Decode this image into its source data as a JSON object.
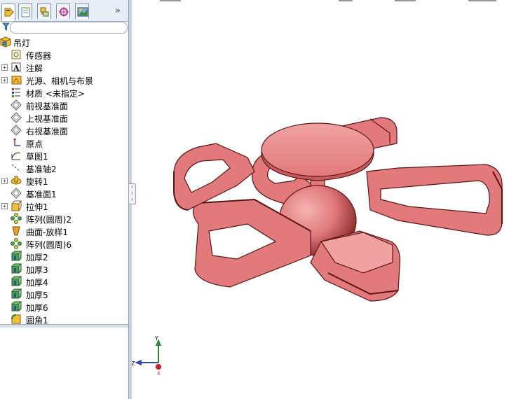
{
  "tabs": [
    {
      "name": "featuremanager-tab-icon",
      "color": "#e7b020"
    },
    {
      "name": "propertymanager-tab-icon",
      "color": "#5a7fb0"
    },
    {
      "name": "configurationmanager-tab-icon",
      "color": "#7a8a3a"
    },
    {
      "name": "dimxpert-tab-icon",
      "color": "#c2308a"
    },
    {
      "name": "display-manager-tab-icon",
      "color": "#3a8a3a"
    }
  ],
  "more_glyph": "»",
  "tree": {
    "root": "吊灯",
    "items": [
      {
        "label": "传感器",
        "icon": "sensor-icon",
        "expand": false
      },
      {
        "label": "注解",
        "icon": "annotation-icon",
        "expand": true
      },
      {
        "label": "光源、相机与布景",
        "icon": "lights-cameras-icon",
        "expand": true
      },
      {
        "label": "材质 <未指定>",
        "icon": "material-icon",
        "expand": false
      },
      {
        "label": "前视基准面",
        "icon": "plane-icon",
        "expand": false
      },
      {
        "label": "上视基准面",
        "icon": "plane-icon",
        "expand": false
      },
      {
        "label": "右视基准面",
        "icon": "plane-icon",
        "expand": false
      },
      {
        "label": "原点",
        "icon": "origin-icon",
        "expand": false
      },
      {
        "label": "草图1",
        "icon": "sketch-icon",
        "expand": false
      },
      {
        "label": "基准轴2",
        "icon": "axis-icon",
        "expand": false
      },
      {
        "label": "旋转1",
        "icon": "revolve-icon",
        "expand": true
      },
      {
        "label": "基准面1",
        "icon": "plane-icon",
        "expand": false
      },
      {
        "label": "拉伸1",
        "icon": "extrude-icon",
        "expand": true
      },
      {
        "label": "阵列(圆周)2",
        "icon": "circular-pattern-icon",
        "expand": false
      },
      {
        "label": "曲面-放样1",
        "icon": "surface-loft-icon",
        "expand": false
      },
      {
        "label": "阵列(圆周)6",
        "icon": "circular-pattern-icon",
        "expand": false
      },
      {
        "label": "加厚2",
        "icon": "thicken-icon",
        "expand": false
      },
      {
        "label": "加厚3",
        "icon": "thicken-icon",
        "expand": false
      },
      {
        "label": "加厚4",
        "icon": "thicken-icon",
        "expand": false
      },
      {
        "label": "加厚5",
        "icon": "thicken-icon",
        "expand": false
      },
      {
        "label": "加厚6",
        "icon": "thicken-icon",
        "expand": false
      },
      {
        "label": "圆角1",
        "icon": "fillet-icon",
        "expand": false
      }
    ]
  },
  "triad": {
    "y": "Y",
    "z": "Z",
    "x": "X"
  },
  "colors": {
    "part": "#e2797b",
    "part_edge": "#5a1414",
    "part_dark": "#c85a5c",
    "part_light": "#f0a2a2"
  }
}
